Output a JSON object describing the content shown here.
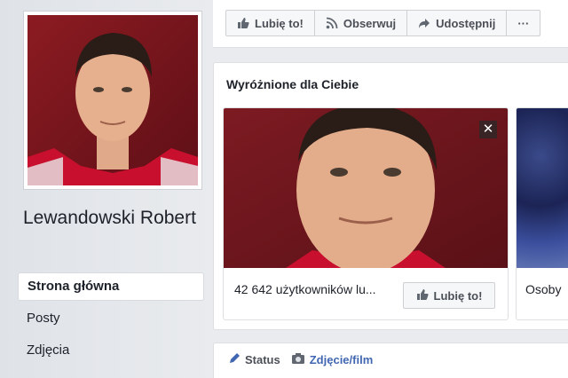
{
  "profile": {
    "name": "Lewandowski Robert"
  },
  "nav": {
    "items": [
      {
        "label": "Strona główna",
        "active": true
      },
      {
        "label": "Posty",
        "active": false
      },
      {
        "label": "Zdjęcia",
        "active": false
      }
    ]
  },
  "action_bar": {
    "like_label": "Lubię to!",
    "follow_label": "Obserwuj",
    "share_label": "Udostępnij",
    "more_label": "···"
  },
  "featured": {
    "title": "Wyróżnione dla Ciebie",
    "card": {
      "info": "42 642 użytkowników lu...",
      "like_label": "Lubię to!",
      "close_label": "✕"
    },
    "card2": {
      "label": "Osoby"
    }
  },
  "composer": {
    "status_label": "Status",
    "photo_label": "Zdjęcie/film"
  },
  "colors": {
    "accent": "#4267b2",
    "background": "#e9ebee",
    "jersey_red": "#c8102e"
  }
}
